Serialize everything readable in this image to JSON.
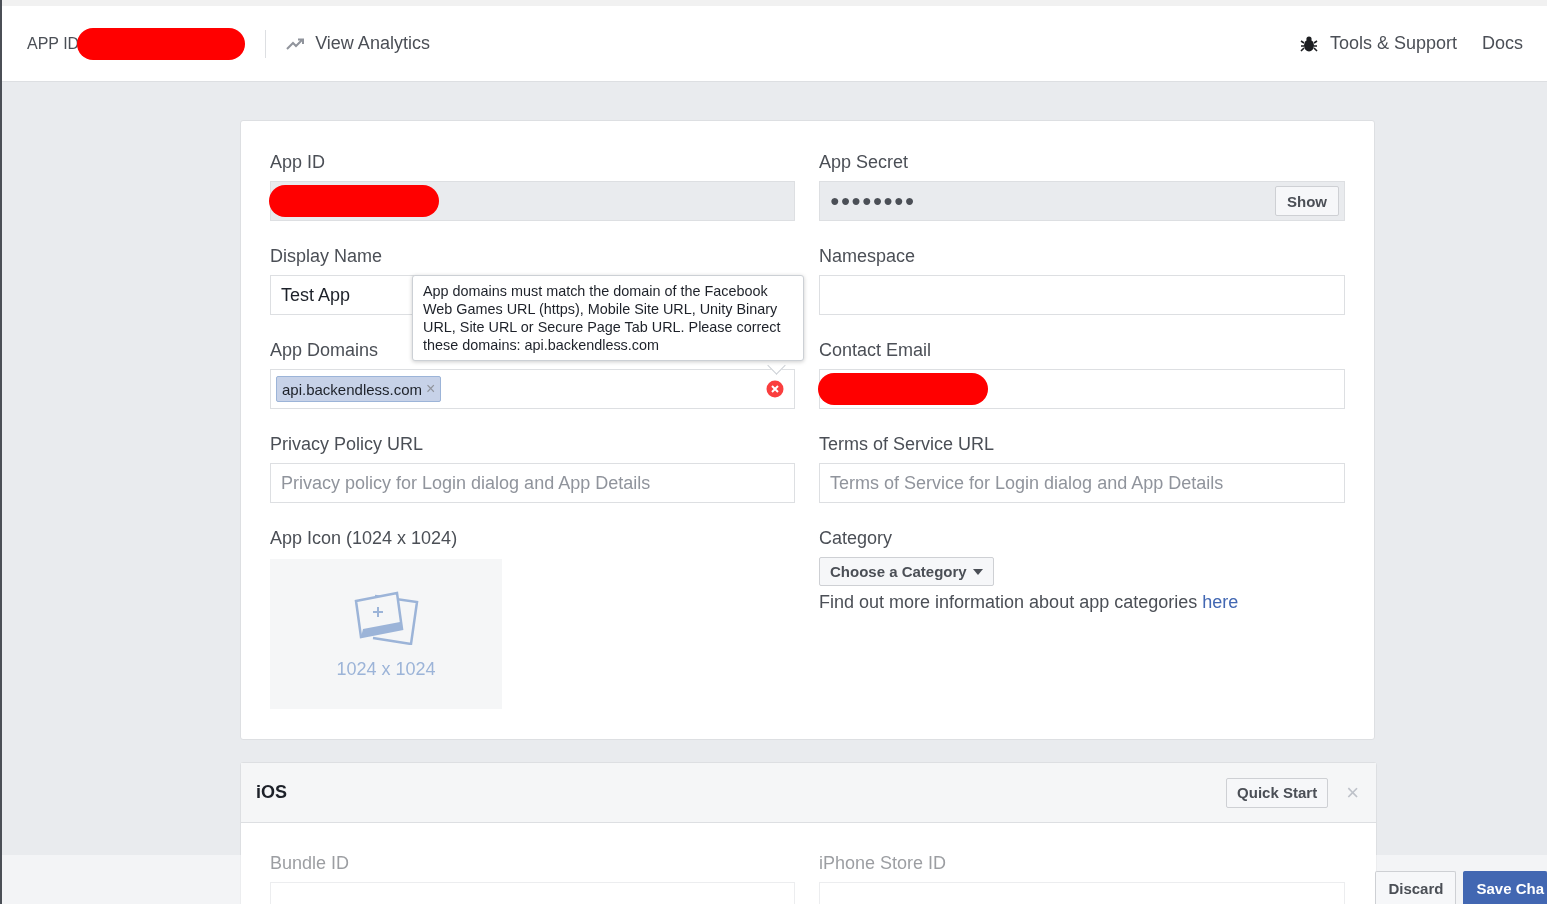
{
  "nav": {
    "app_id_label": "APP ID",
    "app_id_redacted": true,
    "analytics_link": "View Analytics",
    "tools_link": "Tools & Support",
    "docs_link": "Docs"
  },
  "settings": {
    "fields": [
      {
        "label": "App ID",
        "kind": "readonly",
        "redacted": true
      },
      {
        "label": "App Secret",
        "kind": "secret",
        "value": "●●●●●●●●",
        "button": "Show"
      },
      {
        "label": "Display Name",
        "kind": "text",
        "value": "Test App"
      },
      {
        "label": "Namespace",
        "kind": "text"
      },
      {
        "label": "App Domains",
        "kind": "tags",
        "tags": [
          {
            "label": "api.backendless.com",
            "remove": "×"
          }
        ],
        "error": true
      },
      {
        "label": "Contact Email",
        "kind": "text",
        "redacted": true
      },
      {
        "label": "Privacy Policy URL",
        "kind": "text",
        "placeholder": "Privacy policy for Login dialog and App Details"
      },
      {
        "label": "Terms of Service URL",
        "kind": "text",
        "placeholder": "Terms of Service for Login dialog and App Details"
      }
    ],
    "tooltip": "App domains must match the domain of the Facebook Web Games URL (https), Mobile Site URL, Unity Binary URL, Site URL or Secure Page Tab URL. Please correct these domains: api.backendless.com",
    "app_icon": {
      "label": "App Icon (1024 x 1024)",
      "size_hint": "1024 x 1024"
    },
    "category": {
      "label": "Category",
      "dropdown": "Choose a Category",
      "help": "Find out more information about app categories ",
      "help_link": "here"
    }
  },
  "ios": {
    "title": "iOS",
    "quick_start": "Quick Start",
    "close": "×",
    "field_labels": [
      "Bundle ID",
      "iPhone Store ID"
    ]
  },
  "action_bar": {
    "buttons": [
      {
        "label": "Discard",
        "kind": "secondary"
      },
      {
        "label": "Save Cha",
        "kind": "primary"
      }
    ]
  }
}
